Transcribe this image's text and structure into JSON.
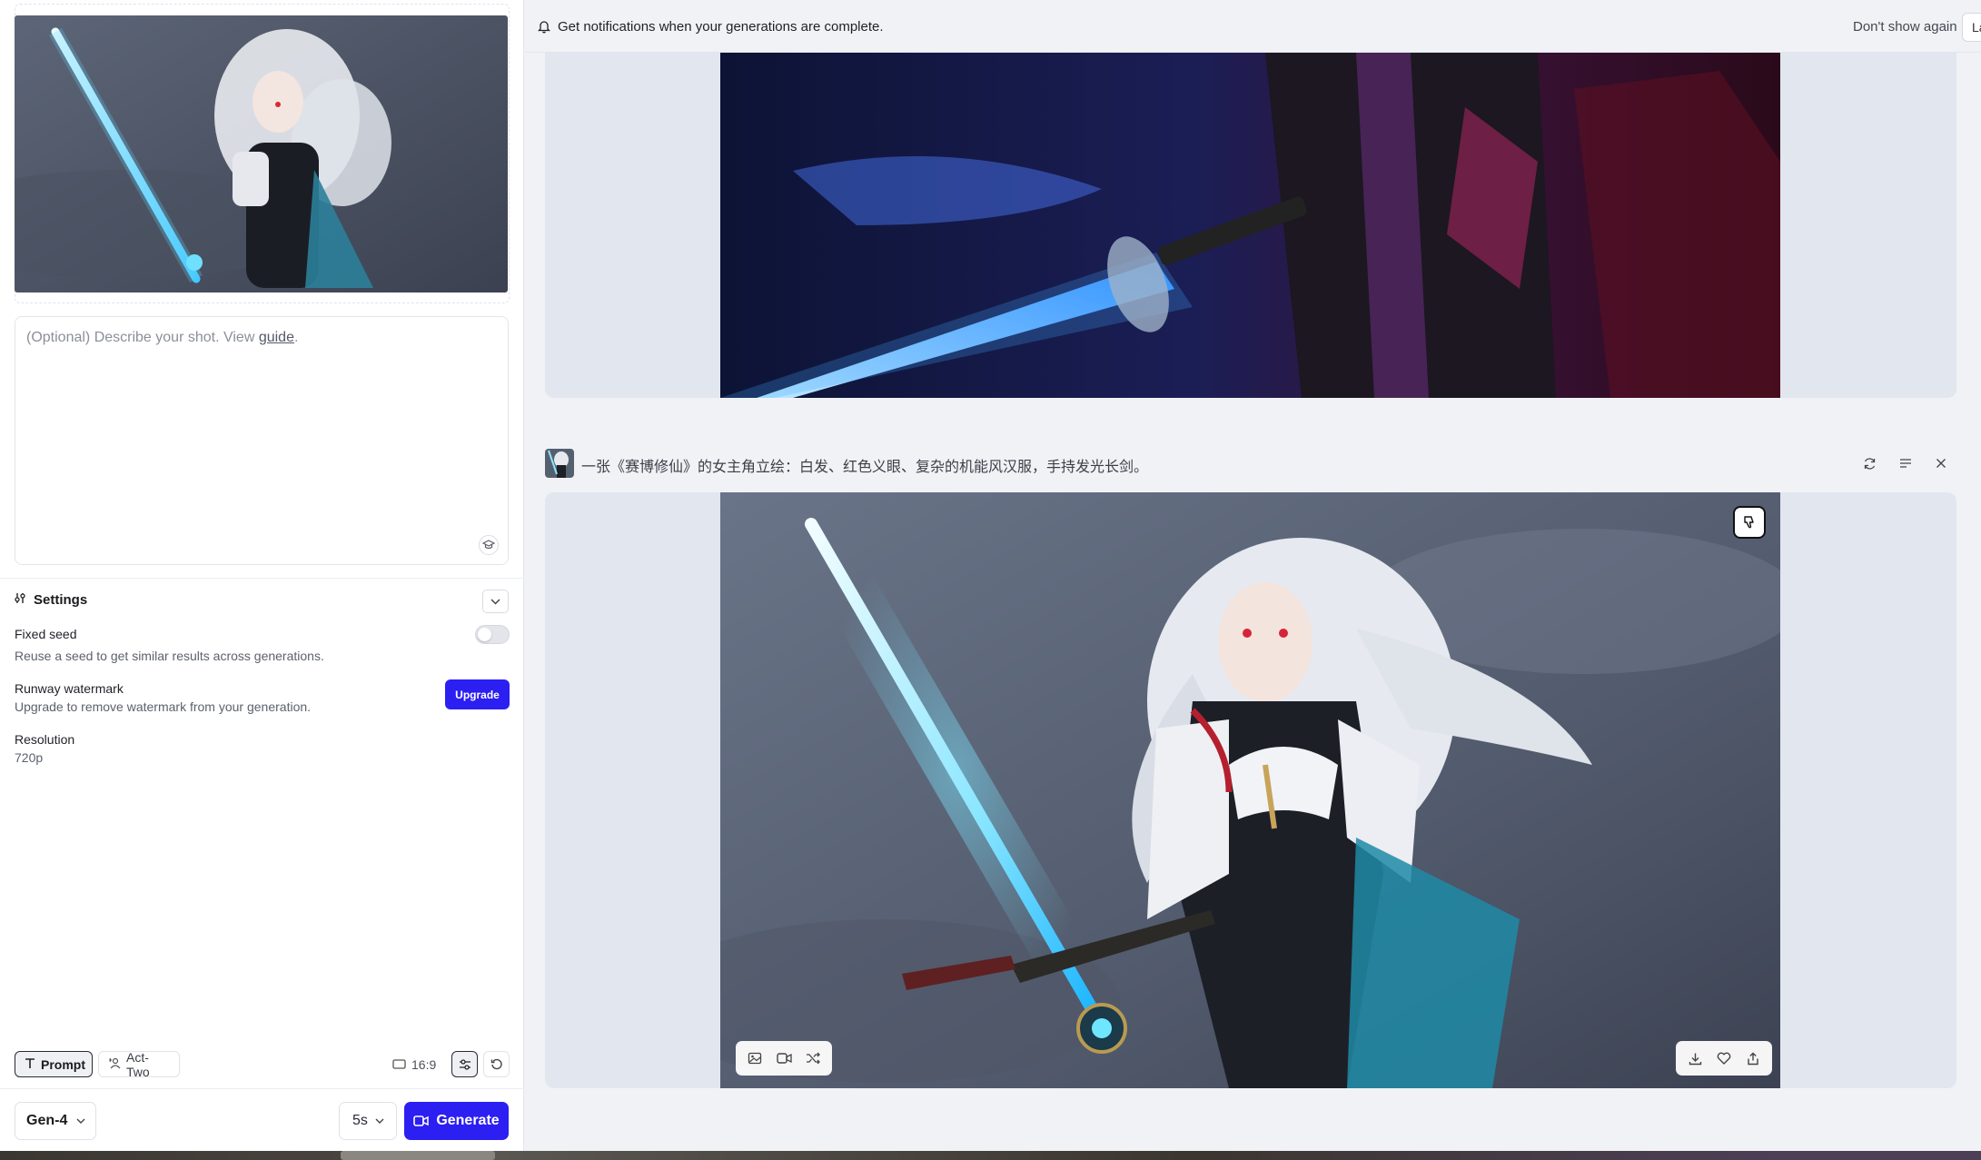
{
  "left_panel": {
    "prompt_placeholder": "(Optional) Describe your shot. View ",
    "prompt_link": "guide",
    "prompt_period": ".",
    "settings": {
      "title": "Settings",
      "fixed_seed_label": "Fixed seed",
      "fixed_seed_desc": "Reuse a seed to get similar results across generations.",
      "watermark_label": "Runway watermark",
      "watermark_desc": "Upgrade to remove watermark from your generation.",
      "upgrade_label": "Upgrade",
      "resolution_label": "Resolution",
      "resolution_value": "720p"
    },
    "modes": {
      "prompt": "Prompt",
      "act_two": "Act-Two"
    },
    "aspect_ratio": "16:9",
    "model": "Gen-4",
    "duration": "5s",
    "generate_label": "Generate"
  },
  "notification": {
    "text": "Get notifications when your generations are complete.",
    "dont_show": "Don't show again",
    "later": "La"
  },
  "task": {
    "prompt_text": "一张《赛博修仙》的女主角立绘：白发、红色义眼、复杂的机能风汉服，手持发光长剑。"
  },
  "colors": {
    "accent": "#2b1ff2",
    "panel_bg": "#ffffff",
    "feed_bg": "#f1f2f6",
    "card_bg": "#e2e6ee"
  },
  "icons": {
    "bell": "bell-icon",
    "settings": "sliders-icon",
    "camera": "video-camera-icon",
    "download": "download-icon",
    "heart": "heart-icon",
    "share": "share-icon"
  }
}
